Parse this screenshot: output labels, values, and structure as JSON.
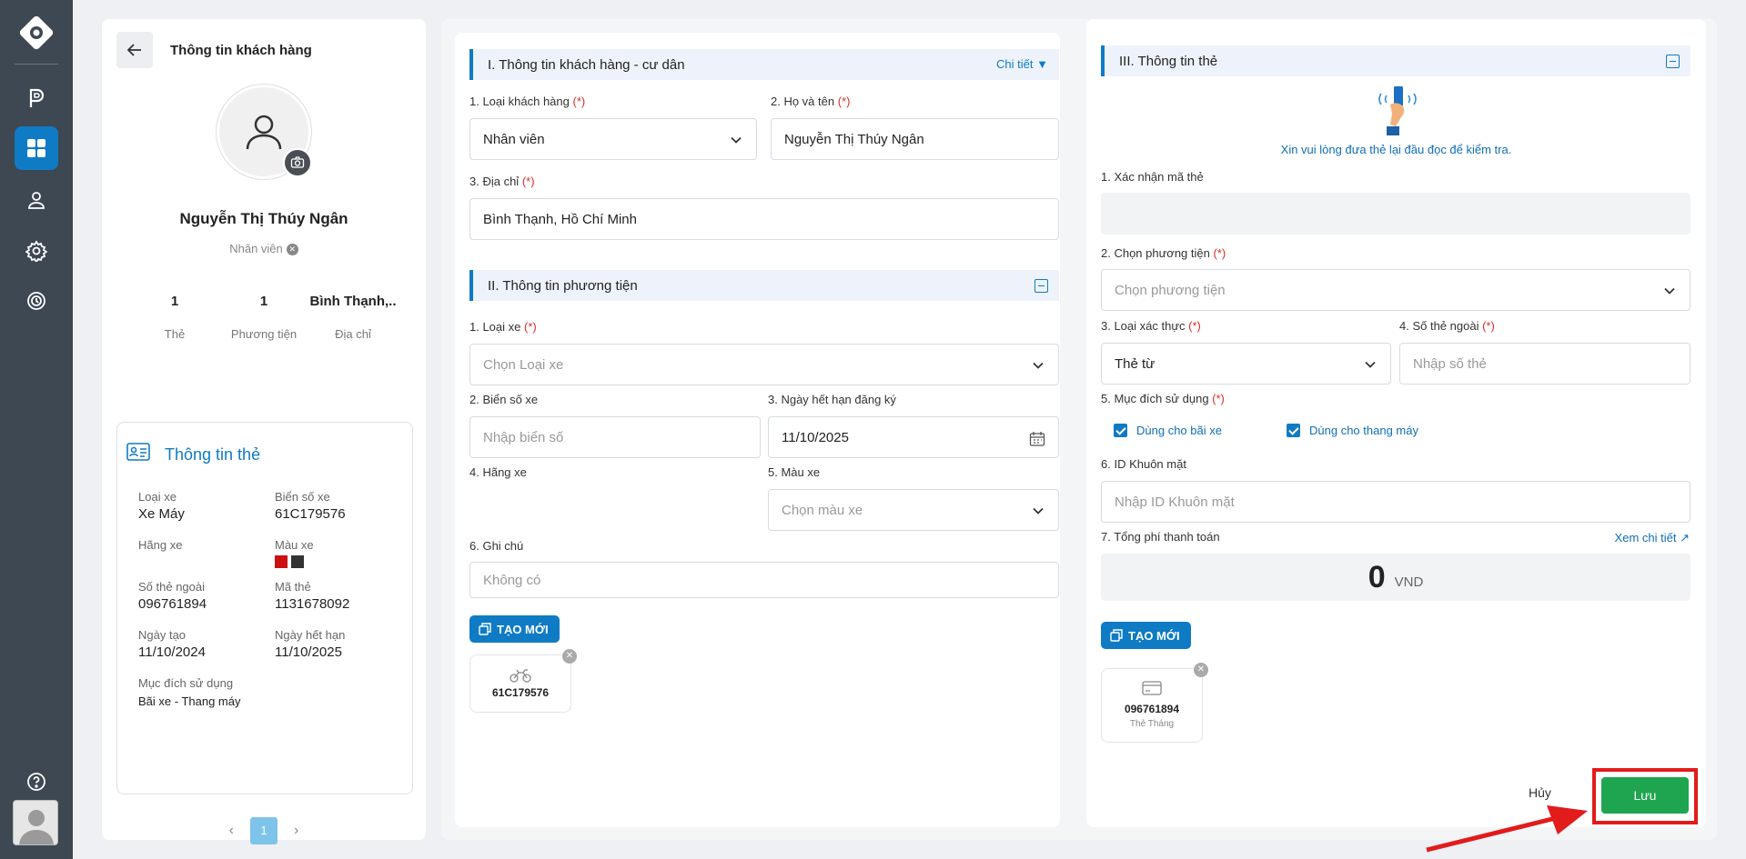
{
  "customer_panel": {
    "title": "Thông tin khách hàng",
    "name": "Nguyễn Thị Thúy Ngân",
    "role": "Nhân viên",
    "stats": [
      {
        "value": "1",
        "label": "Thẻ"
      },
      {
        "value": "1",
        "label": "Phương tiện"
      },
      {
        "value": "Bình Thạnh,..",
        "label": "Địa chỉ"
      }
    ],
    "card_info": {
      "title": "Thông tin thẻ",
      "vehicle_type_label": "Loại xe",
      "vehicle_type": "Xe Máy",
      "plate_label": "Biển số xe",
      "plate": "61C179576",
      "brand_label": "Hãng xe",
      "color_label": "Màu xe",
      "colors": [
        "#cc0f0f",
        "#333333"
      ],
      "external_no_label": "Số thẻ ngoài",
      "external_no": "096761894",
      "card_code_label": "Mã thẻ",
      "card_code": "1131678092",
      "created_label": "Ngày tạo",
      "created": "11/10/2024",
      "expiry_label": "Ngày hết hạn",
      "expiry": "11/10/2025",
      "purpose_label": "Mục đích sử dụng",
      "purpose": "Bãi xe - Thang máy"
    },
    "pager": {
      "prev": "‹",
      "current": "1",
      "next": "›"
    }
  },
  "section1": {
    "title": "I. Thông tin khách hàng - cư dân",
    "detail_link": "Chi tiết",
    "customer_type_label": "1. Loại khách hàng",
    "customer_type_value": "Nhân viên",
    "fullname_label": "2. Họ và tên",
    "fullname_value": "Nguyễn Thị Thúy Ngân",
    "address_label": "3. Địa chỉ",
    "address_value": "Bình Thạnh, Hồ Chí Minh",
    "req": "(*)"
  },
  "section2": {
    "title": "II. Thông tin phương tiện",
    "vehicle_type_label": "1. Loại xe",
    "vehicle_type_placeholder": "Chọn Loại xe",
    "plate_label": "2. Biển số xe",
    "plate_placeholder": "Nhập biển số",
    "reg_expiry_label": "3. Ngày hết hạn đăng ký",
    "reg_expiry_value": "11/10/2025",
    "brand_label": "4. Hãng xe",
    "color_label": "5. Màu xe",
    "color_placeholder": "Chọn màu xe",
    "note_label": "6. Ghi chú",
    "note_placeholder": "Không có",
    "new_button": "TẠO MỚI",
    "vehicle_tile": "61C179576"
  },
  "section3": {
    "title": "III. Thông tin thẻ",
    "reader_hint": "Xin vui lòng đưa thẻ lại đầu đọc để kiểm tra.",
    "confirm_code_label": "1. Xác nhận mã thẻ",
    "choose_vehicle_label": "2. Chọn phương tiện",
    "choose_vehicle_placeholder": "Chọn phương tiện",
    "auth_type_label": "3. Loại xác thực",
    "auth_type_value": "Thẻ từ",
    "ext_card_label": "4. Số thẻ ngoài",
    "ext_card_placeholder": "Nhập số thẻ",
    "purpose_label": "5. Mục đích sử dụng",
    "purpose_parking": "Dùng cho bãi xe",
    "purpose_elevator": "Dùng cho thang máy",
    "face_id_label": "6. ID Khuôn mặt",
    "face_id_placeholder": "Nhập ID Khuôn mặt",
    "total_label": "7. Tổng phí thanh toán",
    "view_detail": "Xem chi tiết",
    "total_value": "0",
    "currency": "VND",
    "new_button": "TẠO MỚI",
    "card_tile_no": "096761894",
    "card_tile_type": "Thẻ Tháng"
  },
  "actions": {
    "cancel": "Hủy",
    "save": "Lưu"
  },
  "colors": {
    "primary": "#0f7bc4",
    "save": "#1fa54f",
    "highlight": "#e21b1b",
    "sidebar": "#3d4852"
  }
}
